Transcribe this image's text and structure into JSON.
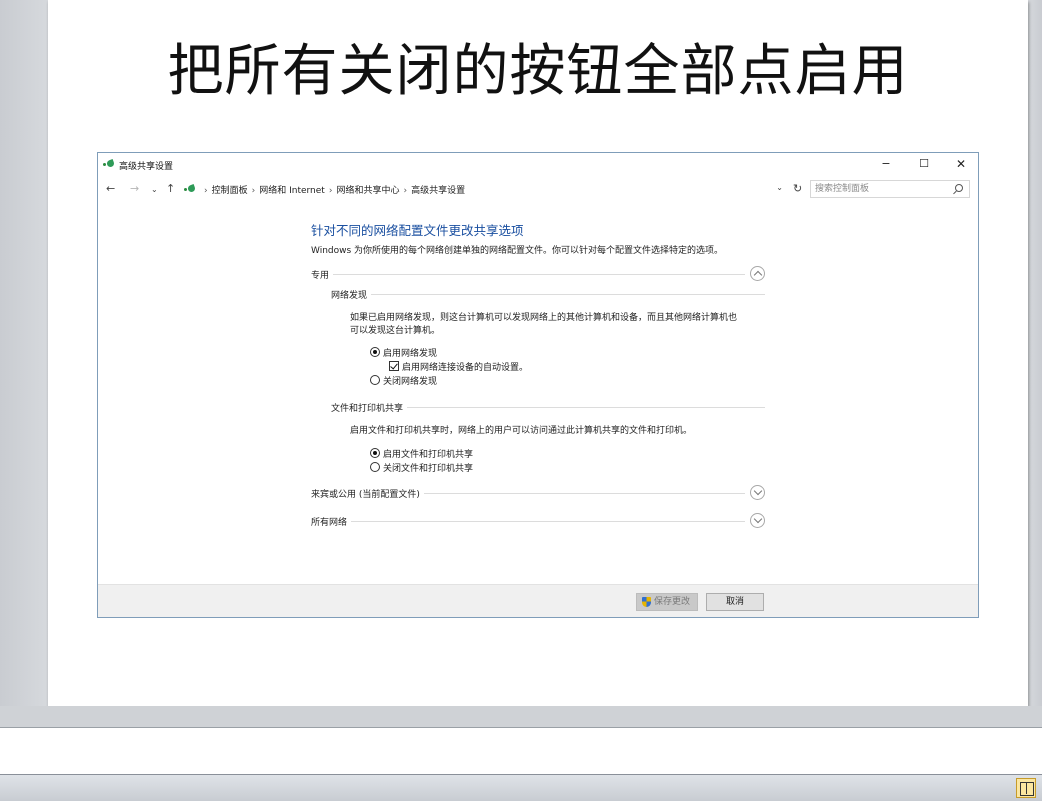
{
  "slide": {
    "title": "把所有关闭的按钮全部点启用"
  },
  "window": {
    "title": "高级共享设置",
    "controls": {
      "minimize": "−",
      "maximize": "☐",
      "close": "✕"
    },
    "nav": {
      "back": "←",
      "forward": "→",
      "recent": "⌄",
      "up": "↑",
      "dropdown": "⌄",
      "refresh": "↻"
    },
    "breadcrumb": [
      "控制面板",
      "网络和 Internet",
      "网络和共享中心",
      "高级共享设置"
    ],
    "search": {
      "placeholder": "搜索控制面板"
    },
    "heading": "针对不同的网络配置文件更改共享选项",
    "description": "Windows 为你所使用的每个网络创建单独的网络配置文件。你可以针对每个配置文件选择特定的选项。",
    "sections": {
      "private": {
        "label": "专用",
        "network_discovery": {
          "label": "网络发现",
          "description_line1": "如果已启用网络发现，则这台计算机可以发现网络上的其他计算机和设备，而且其他网络计算机也",
          "description_line2": "可以发现这台计算机。",
          "option_on": "启用网络发现",
          "auto_setup": "启用网络连接设备的自动设置。",
          "option_off": "关闭网络发现"
        },
        "file_printer": {
          "label": "文件和打印机共享",
          "description": "启用文件和打印机共享时，网络上的用户可以访问通过此计算机共享的文件和打印机。",
          "option_on": "启用文件和打印机共享",
          "option_off": "关闭文件和打印机共享"
        }
      },
      "guest": {
        "label": "来宾或公用 (当前配置文件)"
      },
      "all": {
        "label": "所有网络"
      }
    },
    "footer": {
      "save": "保存更改",
      "cancel": "取消"
    }
  }
}
